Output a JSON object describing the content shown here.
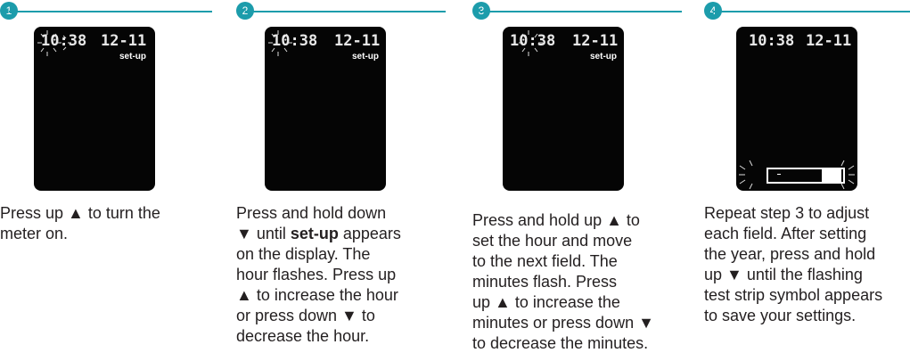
{
  "steps": [
    {
      "number": "1",
      "time": "10:38",
      "date": "12-11",
      "setup_label": "set-up",
      "lines": [
        "Press up ▲ to turn the",
        "meter on."
      ]
    },
    {
      "number": "2",
      "time": "10:38",
      "date": "12-11",
      "setup_label": "set-up",
      "lines": [
        "Press and hold down",
        "▼ until ",
        "set-up",
        " appears",
        "on the display. The",
        "hour flashes. Press up",
        "▲ to increase the hour",
        "or press down ▼ to",
        "decrease the hour."
      ]
    },
    {
      "number": "3",
      "time": "10:38",
      "date": "12-11",
      "setup_label": "set-up",
      "lines": [
        "Press and hold up ▲ to",
        "set the hour and move",
        "to the next field. The",
        "minutes flash. Press",
        "up ▲ to increase the",
        "minutes or press down ▼",
        "to decrease the minutes."
      ]
    },
    {
      "number": "4",
      "time": "10:38",
      "date": "12-11",
      "lines": [
        "Repeat step 3 to adjust",
        "each field. After setting",
        "the year, press and hold",
        "up ▼ until the flashing",
        "test strip symbol appears",
        "to save your settings."
      ]
    }
  ],
  "colors": {
    "accent": "#1c9cab",
    "screen": "#050505",
    "text": "#231f20"
  }
}
